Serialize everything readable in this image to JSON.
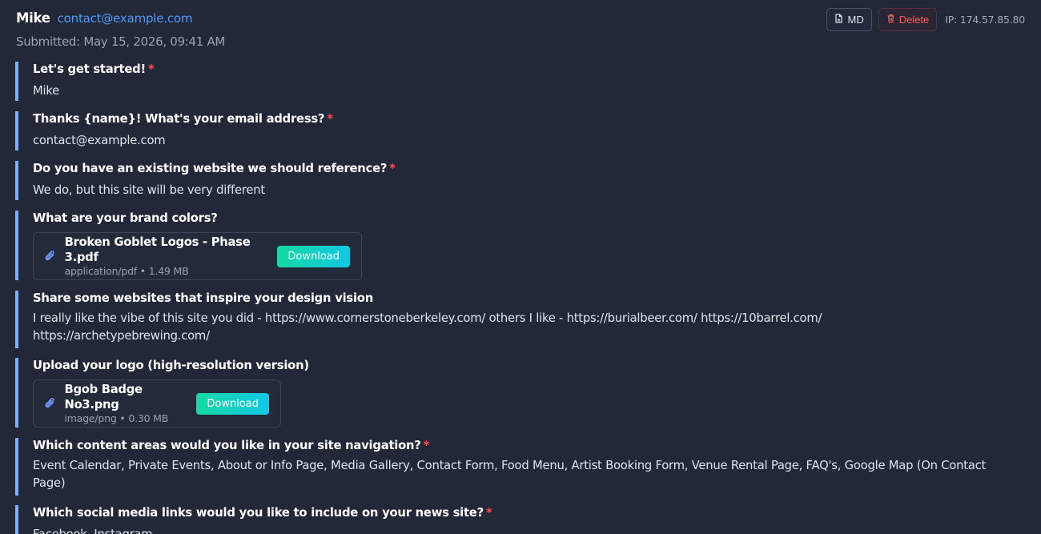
{
  "header": {
    "name": "Mike",
    "email": "contact@example.com",
    "submitted": "Submitted: May 15, 2026, 09:41 AM",
    "md_label": "MD",
    "delete_label": "Delete",
    "ip": "IP: 174.57.85.80"
  },
  "colors": {
    "background": "#222838",
    "accent_bar": "#7fb0ff",
    "link": "#4c9bff",
    "required": "#ff4d4d",
    "delete": "#ff5b5b",
    "download_gradient_start": "#14d9a3",
    "download_gradient_end": "#10c8e6"
  },
  "entries": [
    {
      "question": "Let's get started!",
      "required_mark": "*",
      "answer": "Mike"
    },
    {
      "question": "Thanks {name}! What's your email address?",
      "required_mark": "*",
      "answer": "contact@example.com"
    },
    {
      "question": "Do you have an existing website we should reference?",
      "required_mark": "*",
      "answer": "We do, but this site will be very different"
    },
    {
      "question": "What are your brand colors?",
      "file": {
        "name": "Broken Goblet Logos - Phase 3.pdf",
        "meta": "application/pdf • 1.49 MB",
        "download_label": "Download",
        "icon": "paperclip-icon"
      }
    },
    {
      "question": "Share some websites that inspire your design vision",
      "answer": "I really like the vibe of this site you did - https://www.cornerstoneberkeley.com/ others I like - https://burialbeer.com/ https://10barrel.com/ https://archetypebrewing.com/"
    },
    {
      "question": "Upload your logo (high-resolution version)",
      "file": {
        "name": "Bgob Badge No3.png",
        "meta": "image/png • 0.30 MB",
        "download_label": "Download",
        "icon": "paperclip-icon"
      }
    },
    {
      "question": "Which content areas would you like in your site navigation?",
      "required_mark": "*",
      "answer": "Event Calendar, Private Events, About or Info Page, Media Gallery, Contact Form, Food Menu, Artist Booking Form, Venue Rental Page, FAQ's, Google Map (On Contact Page)"
    },
    {
      "question": "Which social media links would you like to include on your news site?",
      "required_mark": "*",
      "answer": "Facebook, Instagram"
    }
  ]
}
